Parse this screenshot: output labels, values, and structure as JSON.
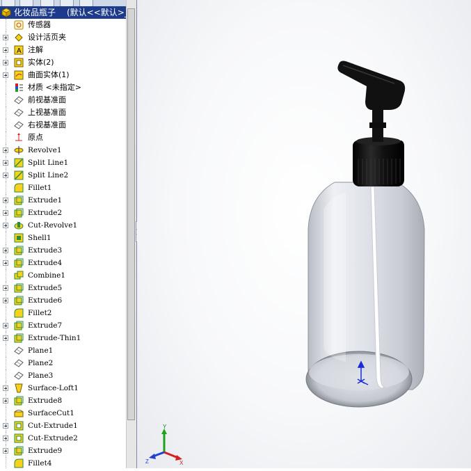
{
  "tree": {
    "root_label": "化妆品瓶子",
    "root_config": "(默认<<默认>_显",
    "items": [
      {
        "label": "传感器",
        "icon": "sensor-icon",
        "expand": false,
        "lang": "zh"
      },
      {
        "label": "设计活页夹",
        "icon": "design-binder-icon",
        "expand": true,
        "lang": "zh"
      },
      {
        "label": "注解",
        "icon": "annotations-icon",
        "expand": true,
        "lang": "zh"
      },
      {
        "label": "实体(2)",
        "icon": "solid-bodies-icon",
        "expand": true,
        "lang": "zh"
      },
      {
        "label": "曲面实体(1)",
        "icon": "surface-bodies-icon",
        "expand": true,
        "lang": "zh"
      },
      {
        "label": "材质 <未指定>",
        "icon": "material-icon",
        "expand": false,
        "lang": "zh"
      },
      {
        "label": "前视基准面",
        "icon": "plane-icon",
        "expand": false,
        "lang": "zh"
      },
      {
        "label": "上视基准面",
        "icon": "plane-icon",
        "expand": false,
        "lang": "zh"
      },
      {
        "label": "右视基准面",
        "icon": "plane-icon",
        "expand": false,
        "lang": "zh"
      },
      {
        "label": "原点",
        "icon": "origin-icon",
        "expand": false,
        "lang": "zh"
      },
      {
        "label": "Revolve1",
        "icon": "revolve-icon",
        "expand": true,
        "lang": "en"
      },
      {
        "label": "Split Line1",
        "icon": "split-line-icon",
        "expand": true,
        "lang": "en"
      },
      {
        "label": "Split Line2",
        "icon": "split-line-icon",
        "expand": true,
        "lang": "en"
      },
      {
        "label": "Fillet1",
        "icon": "fillet-icon",
        "expand": false,
        "lang": "en"
      },
      {
        "label": "Extrude1",
        "icon": "extrude-icon",
        "expand": true,
        "lang": "en"
      },
      {
        "label": "Extrude2",
        "icon": "extrude-icon",
        "expand": true,
        "lang": "en"
      },
      {
        "label": "Cut-Revolve1",
        "icon": "cut-revolve-icon",
        "expand": true,
        "lang": "en"
      },
      {
        "label": "Shell1",
        "icon": "shell-icon",
        "expand": false,
        "lang": "en"
      },
      {
        "label": "Extrude3",
        "icon": "extrude-icon",
        "expand": true,
        "lang": "en"
      },
      {
        "label": "Extrude4",
        "icon": "extrude-icon",
        "expand": true,
        "lang": "en"
      },
      {
        "label": "Combine1",
        "icon": "combine-icon",
        "expand": false,
        "lang": "en"
      },
      {
        "label": "Extrude5",
        "icon": "extrude-icon",
        "expand": true,
        "lang": "en"
      },
      {
        "label": "Extrude6",
        "icon": "extrude-icon",
        "expand": true,
        "lang": "en"
      },
      {
        "label": "Fillet2",
        "icon": "fillet-icon",
        "expand": false,
        "lang": "en"
      },
      {
        "label": "Extrude7",
        "icon": "extrude-icon",
        "expand": true,
        "lang": "en"
      },
      {
        "label": "Extrude-Thin1",
        "icon": "extrude-icon",
        "expand": true,
        "lang": "en"
      },
      {
        "label": "Plane1",
        "icon": "plane-icon",
        "expand": false,
        "lang": "en"
      },
      {
        "label": "Plane2",
        "icon": "plane-icon",
        "expand": false,
        "lang": "en"
      },
      {
        "label": "Plane3",
        "icon": "plane-icon",
        "expand": false,
        "lang": "en"
      },
      {
        "label": "Surface-Loft1",
        "icon": "surface-loft-icon",
        "expand": true,
        "lang": "en"
      },
      {
        "label": "Extrude8",
        "icon": "extrude-icon",
        "expand": true,
        "lang": "en"
      },
      {
        "label": "SurfaceCut1",
        "icon": "surface-cut-icon",
        "expand": false,
        "lang": "en"
      },
      {
        "label": "Cut-Extrude1",
        "icon": "cut-extrude-icon",
        "expand": true,
        "lang": "en"
      },
      {
        "label": "Cut-Extrude2",
        "icon": "cut-extrude-icon",
        "expand": true,
        "lang": "en"
      },
      {
        "label": "Extrude9",
        "icon": "extrude-icon",
        "expand": true,
        "lang": "en"
      },
      {
        "label": "Fillet4",
        "icon": "fillet-icon",
        "expand": false,
        "lang": "en"
      }
    ]
  },
  "triad": {
    "x_label": "X",
    "y_label": "Y",
    "z_label": "Z"
  },
  "colors": {
    "selection": "#1e3a8a",
    "feature_yellow": "#f6d21c",
    "feature_green": "#2e8b3a",
    "axis_x": "#d62020",
    "axis_y": "#20a020",
    "axis_z": "#2040d0",
    "pump": "#111111"
  }
}
